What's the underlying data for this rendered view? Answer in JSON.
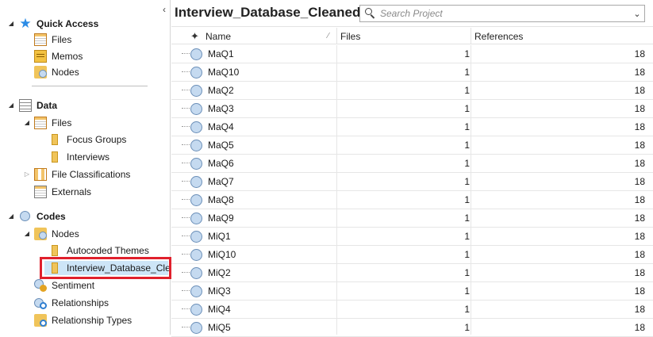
{
  "sidebar": {
    "collapse_glyph": "‹",
    "sections": {
      "quick_access": {
        "label": "Quick Access",
        "items": [
          "Files",
          "Memos",
          "Nodes"
        ]
      },
      "data": {
        "label": "Data",
        "files": "Files",
        "focus_groups": "Focus Groups",
        "interviews": "Interviews",
        "file_classifications": "File Classifications",
        "externals": "Externals"
      },
      "codes": {
        "label": "Codes",
        "nodes": "Nodes",
        "autocoded_themes": "Autocoded Themes",
        "interview_db": "Interview_Database_Cle",
        "sentiment": "Sentiment",
        "relationships": "Relationships",
        "relationship_types": "Relationship Types"
      }
    },
    "highlight_color": "#e0202c"
  },
  "main": {
    "title": "Interview_Database_Cleaned",
    "search": {
      "placeholder": "Search Project",
      "value": ""
    },
    "columns": {
      "name": "Name",
      "files": "Files",
      "references": "References"
    },
    "rows": [
      {
        "name": "MaQ1",
        "files": "1",
        "references": "18"
      },
      {
        "name": "MaQ10",
        "files": "1",
        "references": "18"
      },
      {
        "name": "MaQ2",
        "files": "1",
        "references": "18"
      },
      {
        "name": "MaQ3",
        "files": "1",
        "references": "18"
      },
      {
        "name": "MaQ4",
        "files": "1",
        "references": "18"
      },
      {
        "name": "MaQ5",
        "files": "1",
        "references": "18"
      },
      {
        "name": "MaQ6",
        "files": "1",
        "references": "18"
      },
      {
        "name": "MaQ7",
        "files": "1",
        "references": "18"
      },
      {
        "name": "MaQ8",
        "files": "1",
        "references": "18"
      },
      {
        "name": "MaQ9",
        "files": "1",
        "references": "18"
      },
      {
        "name": "MiQ1",
        "files": "1",
        "references": "18"
      },
      {
        "name": "MiQ10",
        "files": "1",
        "references": "18"
      },
      {
        "name": "MiQ2",
        "files": "1",
        "references": "18"
      },
      {
        "name": "MiQ3",
        "files": "1",
        "references": "18"
      },
      {
        "name": "MiQ4",
        "files": "1",
        "references": "18"
      },
      {
        "name": "MiQ5",
        "files": "1",
        "references": "18"
      }
    ]
  }
}
